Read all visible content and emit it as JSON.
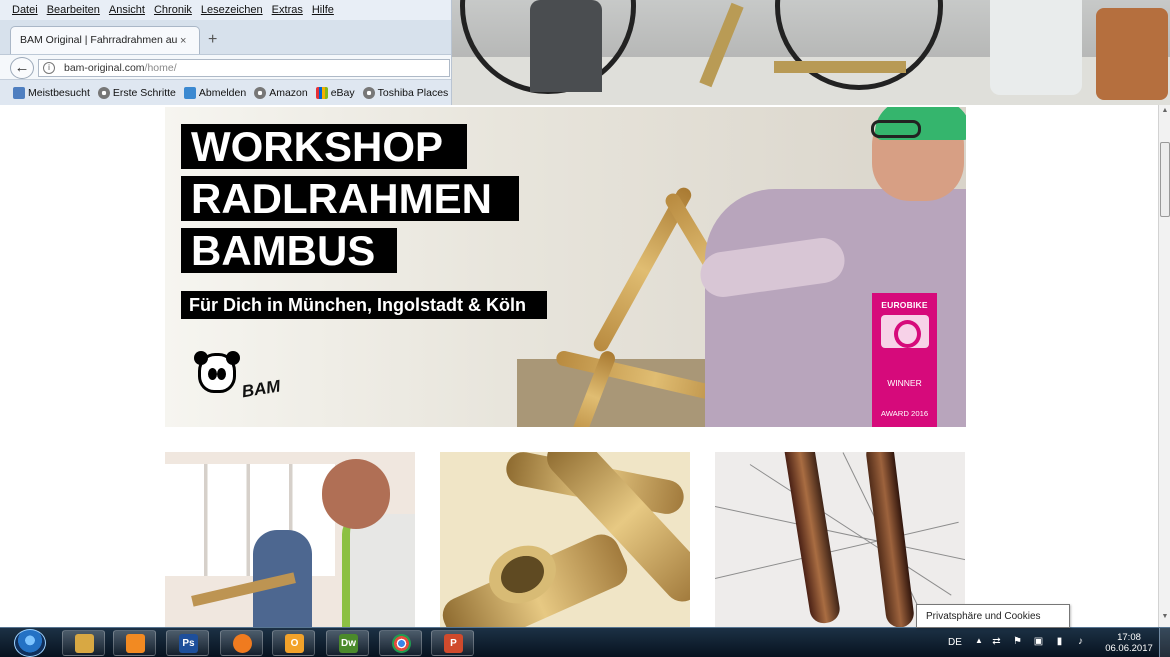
{
  "browser": {
    "menu": [
      "Datei",
      "Bearbeiten",
      "Ansicht",
      "Chronik",
      "Lesezeichen",
      "Extras",
      "Hilfe"
    ],
    "tab_title": "BAM Original | Fahrradrahmen au",
    "url_domain": "bam-original.com",
    "url_path": "/home/",
    "bookmarks": [
      {
        "label": "Meistbesucht",
        "icon": "blue-star-icon"
      },
      {
        "label": "Erste Schritte",
        "icon": "globe-icon"
      },
      {
        "label": "Abmelden",
        "icon": "blue-page-icon"
      },
      {
        "label": "Amazon",
        "icon": "globe-icon"
      },
      {
        "label": "eBay",
        "icon": "colored-bag-icon"
      },
      {
        "label": "Toshiba Places",
        "icon": "globe-icon"
      }
    ]
  },
  "hero": {
    "title_lines": [
      "WORKSHOP",
      "RADLRAHMEN",
      "BAMBUS"
    ],
    "subtitle": "Für Dich in München, Ingolstadt & Köln",
    "logo_text": "BAM",
    "award": {
      "brand": "EUROBIKE",
      "status": "WINNER",
      "year": "AWARD 2016"
    }
  },
  "tooltip": "Privatsphäre und Cookies",
  "taskbar": {
    "language": "DE",
    "time": "17:08",
    "date": "06.06.2017",
    "apps": [
      {
        "name": "explorer-icon",
        "glyph": "",
        "color": "#d8a843"
      },
      {
        "name": "media-player-icon",
        "glyph": "",
        "color": "#f28a22"
      },
      {
        "name": "photoshop-icon",
        "glyph": "Ps",
        "color": "#1e4f9b"
      },
      {
        "name": "firefox-icon",
        "glyph": "",
        "color": "#f07b1f"
      },
      {
        "name": "outlook-icon",
        "glyph": "O",
        "color": "#f2a22a"
      },
      {
        "name": "dreamweaver-icon",
        "glyph": "Dw",
        "color": "#4b8a2b"
      },
      {
        "name": "chrome-icon",
        "glyph": "",
        "color": "#2f9b4a"
      },
      {
        "name": "powerpoint-icon",
        "glyph": "P",
        "color": "#d04a2c"
      }
    ]
  }
}
